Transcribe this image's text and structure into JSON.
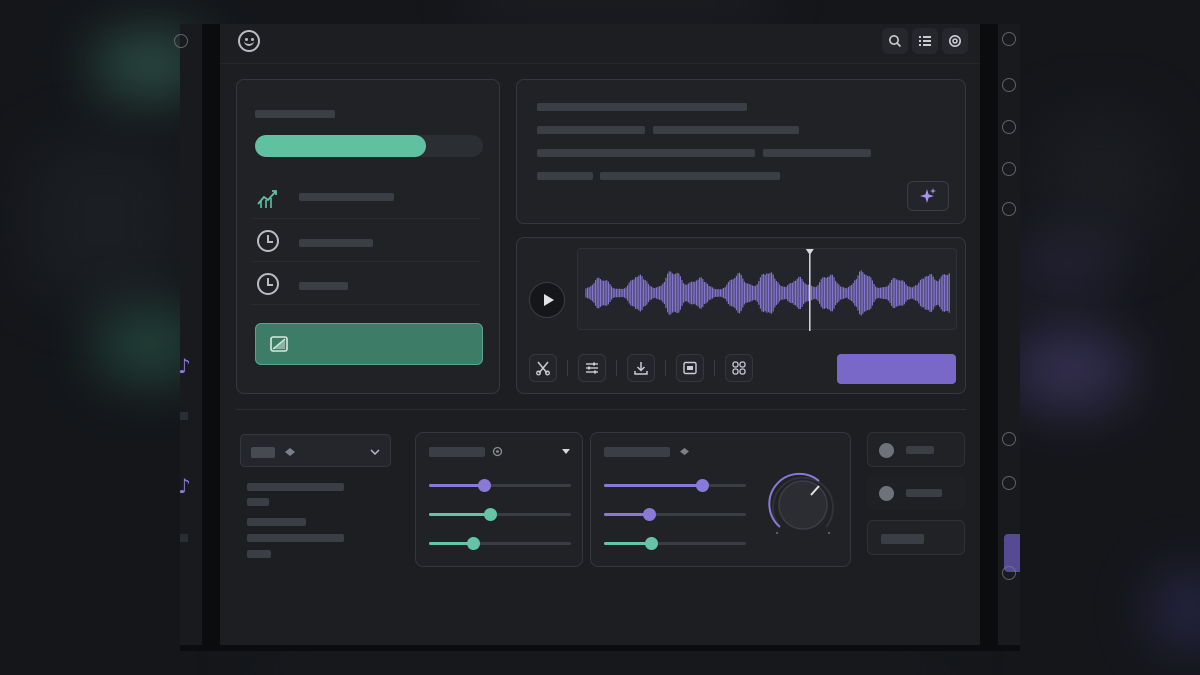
{
  "window": {
    "title": "",
    "toolbar_icons": [
      "search-icon",
      "list-icon",
      "settings-icon"
    ]
  },
  "left_panel": {
    "progress": 0.75,
    "items": [
      {
        "icon": "chart-growth-icon"
      },
      {
        "icon": "clock-icon"
      },
      {
        "icon": "clock-icon"
      }
    ],
    "action_icon": "image-icon"
  },
  "text_panel": {
    "action_icon": "sparkle-icon"
  },
  "audio_panel": {
    "playhead": 0.61,
    "tools": [
      "scissors-icon",
      "sliders-icon",
      "download-icon",
      "image-icon",
      "apps-icon"
    ]
  },
  "sliders_panel_1": {
    "values": [
      0.39,
      0.43,
      0.31
    ]
  },
  "sliders_panel_2": {
    "values": [
      0.69,
      0.32,
      0.33
    ]
  },
  "colors": {
    "accent_green": "#5fc1a0",
    "accent_purple": "#7a68c9",
    "background": "#1c1e22"
  }
}
